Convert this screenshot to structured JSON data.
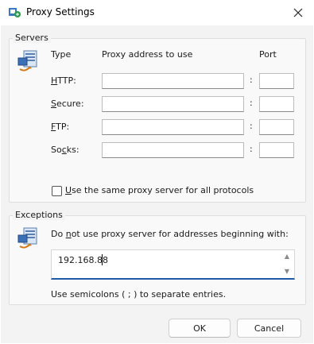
{
  "window": {
    "title": "Proxy Settings",
    "icon": "proxy-settings-icon",
    "close_icon": "close-icon"
  },
  "servers": {
    "group_label": "Servers",
    "col_type": "Type",
    "col_address": "Proxy address to use",
    "col_port": "Port",
    "rows": [
      {
        "label_mnemonic": "H",
        "label_rest": "TTP:",
        "address": "",
        "port": ""
      },
      {
        "label_mnemonic": "S",
        "label_rest": "ecure:",
        "address": "",
        "port": ""
      },
      {
        "label_mnemonic": "F",
        "label_rest": "TP:",
        "address": "",
        "port": ""
      },
      {
        "label_pre": "So",
        "label_mnemonic": "c",
        "label_rest": "ks:",
        "address": "",
        "port": ""
      }
    ],
    "colon": ":",
    "same_proxy_mnemonic": "U",
    "same_proxy_rest": "se the same proxy server for all protocols",
    "same_proxy_checked": false
  },
  "exceptions": {
    "group_label": "Exceptions",
    "text_pre": "Do ",
    "text_mnemonic": "n",
    "text_rest": "ot use proxy server for addresses beginning with:",
    "value": "192.168.88",
    "hint": "Use semicolons ( ; ) to separate entries."
  },
  "buttons": {
    "ok": "OK",
    "cancel": "Cancel"
  }
}
